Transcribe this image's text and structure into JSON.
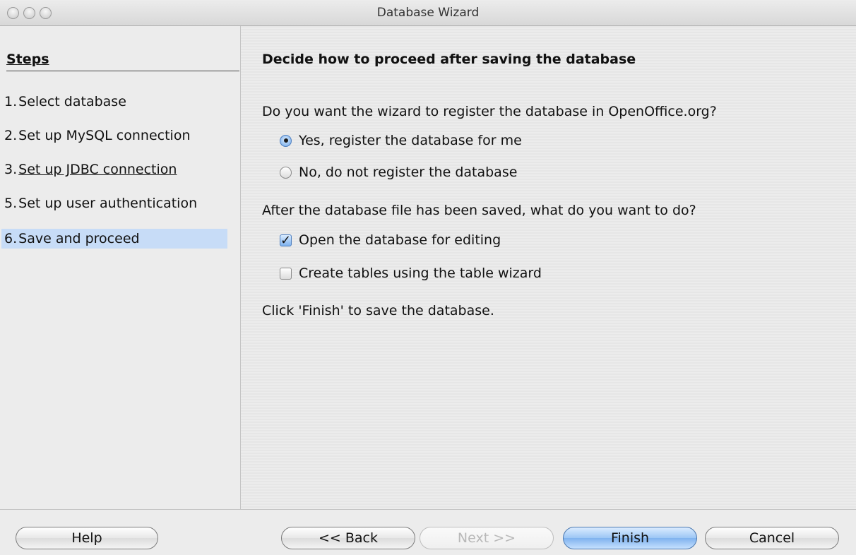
{
  "window": {
    "title": "Database Wizard"
  },
  "sidebar": {
    "heading": "Steps",
    "items": [
      {
        "num": "1.",
        "label": "Select database",
        "state": "normal"
      },
      {
        "num": "2.",
        "label": "Set up MySQL connection",
        "state": "normal"
      },
      {
        "num": "3.",
        "label": "Set up JDBC connection",
        "state": "link"
      },
      {
        "num": "5.",
        "label": "Set up user authentication",
        "state": "normal"
      },
      {
        "num": "6.",
        "label": "Save and proceed",
        "state": "active"
      }
    ]
  },
  "main": {
    "title": "Decide how to proceed after saving the database",
    "register_question": "Do you want the wizard to register the database in OpenOffice.org?",
    "register_options": [
      {
        "label": "Yes, register the database for me",
        "selected": true
      },
      {
        "label": "No, do not register the database",
        "selected": false
      }
    ],
    "after_question": "After the database file has been saved, what do you want to do?",
    "after_options": [
      {
        "label": "Open the database for editing",
        "checked": true
      },
      {
        "label": "Create tables using the table wizard",
        "checked": false
      }
    ],
    "finish_note": "Click 'Finish' to save the database."
  },
  "buttons": {
    "help": "Help",
    "back": "<< Back",
    "next": "Next >>",
    "finish": "Finish",
    "cancel": "Cancel"
  },
  "colors": {
    "active_step": "#c7dcf7",
    "default_button": "#7fb2ee"
  }
}
